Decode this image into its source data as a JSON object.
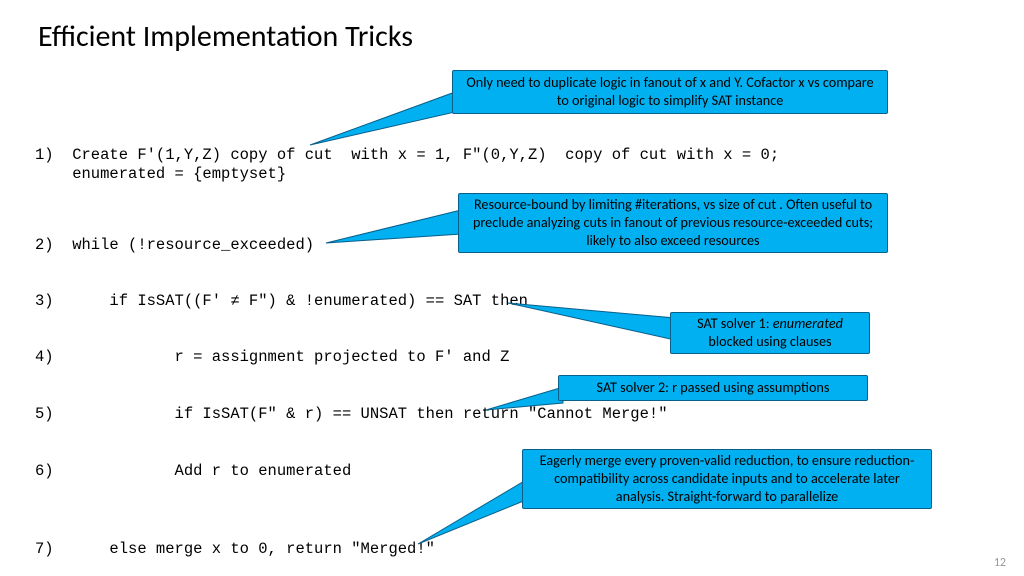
{
  "title": "Efficient Implementation Tricks",
  "code": {
    "l1a": "1)  Create F'(1,Y,Z) copy of cut  with x = 1, F\"(0,Y,Z)  copy of cut with x = 0;",
    "l1b": "    enumerated = {emptyset}",
    "l2": "2)  while (!resource_exceeded)",
    "l3": "3)      if IsSAT((F' ≠ F\") & !enumerated) == SAT then",
    "l4": "4)             r = assignment projected to F' and Z",
    "l5": "5)             if IsSAT(F\" & r) == UNSAT then return \"Cannot Merge!\"",
    "l6": "6)             Add r to enumerated",
    "l7": "7)      else merge x to 0, return \"Merged!\""
  },
  "callouts": {
    "c1": "Only need to duplicate logic in fanout of x and Y. Cofactor x vs compare to original logic to simplify SAT instance",
    "c2": "Resource-bound by limiting #iterations, vs size of cut . Often useful to preclude analyzing cuts in fanout of previous resource-exceeded cuts; likely to also exceed resources",
    "c3_a": "SAT solver 1: ",
    "c3_b": "enumerated",
    "c3_c": " blocked using clauses",
    "c4": "SAT solver 2: r passed using assumptions",
    "c5": "Eagerly merge every proven-valid reduction, to ensure reduction-compatibility across candidate inputs and to accelerate later analysis. Straight-forward to parallelize"
  },
  "page": "12"
}
